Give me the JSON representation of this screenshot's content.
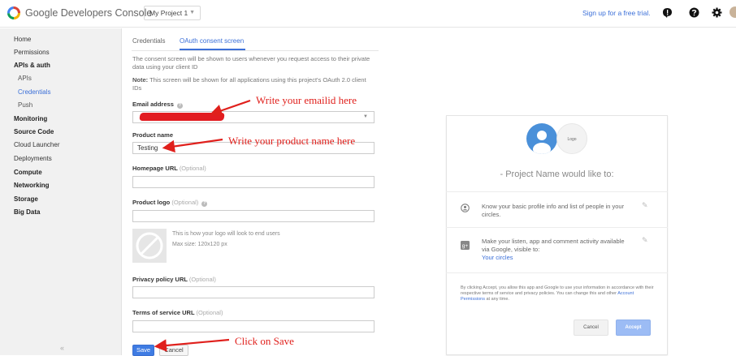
{
  "header": {
    "app_title": "Google Developers Console",
    "project": "My Project 1",
    "signup": "Sign up for a free trial."
  },
  "sidebar": {
    "items": [
      {
        "label": "Home",
        "style": "normal"
      },
      {
        "label": "Permissions",
        "style": "normal"
      },
      {
        "label": "APIs & auth",
        "style": "bold"
      },
      {
        "label": "APIs",
        "style": "sub"
      },
      {
        "label": "Credentials",
        "style": "sub-active"
      },
      {
        "label": "Push",
        "style": "sub"
      },
      {
        "label": "Monitoring",
        "style": "bold"
      },
      {
        "label": "Source Code",
        "style": "bold"
      },
      {
        "label": "Cloud Launcher",
        "style": "normal"
      },
      {
        "label": "Deployments",
        "style": "normal"
      },
      {
        "label": "Compute",
        "style": "bold"
      },
      {
        "label": "Networking",
        "style": "bold"
      },
      {
        "label": "Storage",
        "style": "bold"
      },
      {
        "label": "Big Data",
        "style": "bold"
      }
    ],
    "collapse": "«"
  },
  "tabs": [
    {
      "label": "Credentials",
      "active": false
    },
    {
      "label": "OAuth consent screen",
      "active": true
    }
  ],
  "form": {
    "intro": "The consent screen will be shown to users whenever you request access to their private data using your client ID",
    "note_label": "Note:",
    "note_text": " This screen will be shown for all applications using this project's OAuth 2.0 client IDs",
    "email_label": "Email address",
    "product_label": "Product name",
    "product_value": "Testing",
    "homepage_label": "Homepage URL",
    "optional": "(Optional)",
    "logo_label": "Product logo",
    "logo_note1": "This is how your logo will look to end users",
    "logo_note2": "Max size: 120x120 px",
    "privacy_label": "Privacy policy URL",
    "tos_label": "Terms of service URL",
    "save": "Save",
    "cancel": "Cancel"
  },
  "annotations": {
    "email": "Write your emailid here",
    "product": "Write your product name here",
    "save": "Click on Save"
  },
  "preview": {
    "logo_text": "Logo",
    "title": "- Project Name would like to:",
    "perm1": "Know your basic profile info and list of people in your circles.",
    "perm2": "Make your listen, app and comment activity available via Google, visible to:",
    "perm2_link": "Your circles",
    "footer_pre": "By clicking Accept, you allow this app and Google to use your information in accordance with their respective terms of service and privacy policies. You can change this and other ",
    "footer_link": "Account Permissions",
    "footer_post": " at any time.",
    "cancel": "Cancel",
    "accept": "Accept"
  },
  "colors": {
    "accent": "#3b6fd8",
    "annotation": "#e0201c",
    "save_button": "#3f7ce3"
  }
}
